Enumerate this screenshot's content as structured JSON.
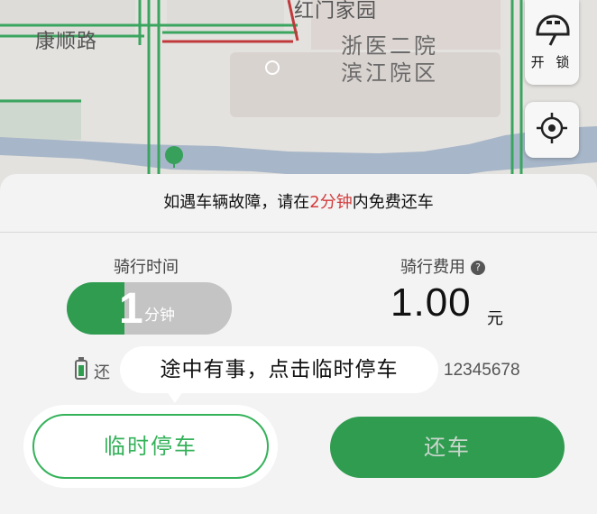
{
  "map": {
    "road_labels": [
      "康顺路",
      "红门家园"
    ],
    "poi_label_line1": "浙医二院",
    "poi_label_line2": "滨江院区"
  },
  "side_buttons": {
    "unlock_label": "开 锁",
    "unlock_icon": "helmet-icon",
    "locate_icon": "crosshair-icon"
  },
  "notice": {
    "prefix": "如遇车辆故障，请在",
    "highlight": "2分钟",
    "suffix": "内免费还车",
    "highlight_color": "#d23b3b"
  },
  "ride_time": {
    "label": "骑行时间",
    "value": "1",
    "unit": "分钟"
  },
  "ride_fee": {
    "label": "骑行费用",
    "value": "1.00",
    "unit": "元"
  },
  "status_row": {
    "battery_icon": "battery-icon",
    "left_text": "还",
    "bike_number": "12345678"
  },
  "tooltip": {
    "text": "途中有事，点击临时停车"
  },
  "buttons": {
    "temp_park": "临时停车",
    "return_bike": "还车"
  },
  "colors": {
    "primary_green": "#2f9c50",
    "outline_green": "#35b25a"
  }
}
